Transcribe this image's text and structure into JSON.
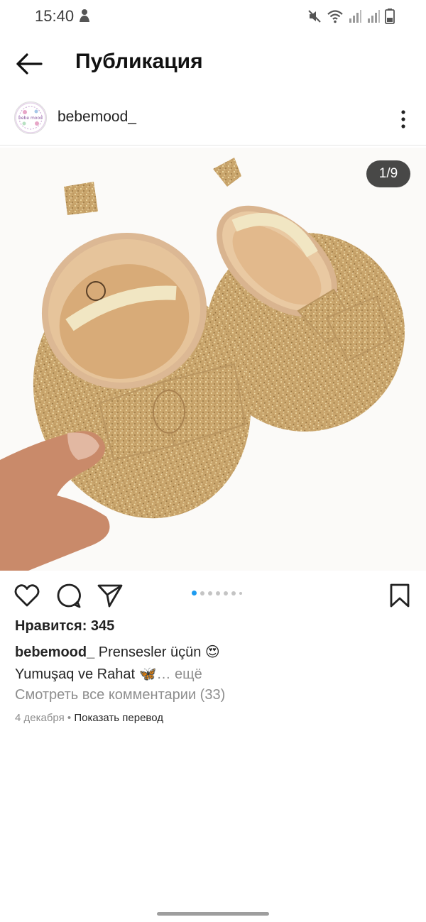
{
  "status_bar": {
    "time": "15:40",
    "icons": [
      "person-icon",
      "mute-icon",
      "wifi-icon",
      "signal-icon",
      "signal-icon",
      "battery-icon"
    ]
  },
  "header": {
    "title": "Публикация",
    "back_icon": "arrow-left-icon"
  },
  "post": {
    "username": "bebemood_",
    "avatar_text": "bebe mood",
    "more_icon": "vertical-dots-icon",
    "media": {
      "counter": "1/9",
      "description_icon": "baby-shoes-photo"
    },
    "carousel": {
      "total_dots": 7,
      "active_index": 0
    },
    "actions": [
      "heart-icon",
      "comment-icon",
      "share-icon",
      "bookmark-icon"
    ],
    "likes": "Нравится: 345",
    "caption": {
      "user": "bebemood_",
      "line1": " Prensesler üçün 😍",
      "line2": "Yumuşaq ve Rahat 🦋",
      "more": "… ещё"
    },
    "view_comments": "Смотреть все комментарии (33)",
    "date": "4 декабря",
    "separator": " • ",
    "translate": "Показать перевод"
  },
  "colors": {
    "accent_dot": "#1d9bf0",
    "muted_text": "#8e8e8e",
    "text": "#262626"
  }
}
